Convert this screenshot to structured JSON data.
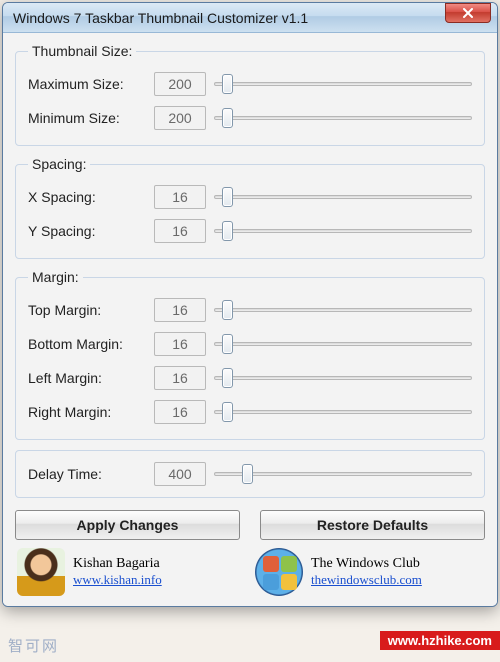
{
  "window": {
    "title": "Windows 7 Taskbar Thumbnail Customizer v1.1"
  },
  "groups": {
    "thumb": {
      "legend": "Thumbnail Size:",
      "max_label": "Maximum Size:",
      "max_value": "200",
      "min_label": "Minimum Size:",
      "min_value": "200"
    },
    "spacing": {
      "legend": "Spacing:",
      "x_label": "X Spacing:",
      "x_value": "16",
      "y_label": "Y Spacing:",
      "y_value": "16"
    },
    "margin": {
      "legend": "Margin:",
      "top_label": "Top Margin:",
      "top_value": "16",
      "bottom_label": "Bottom Margin:",
      "bottom_value": "16",
      "left_label": "Left Margin:",
      "left_value": "16",
      "right_label": "Right Margin:",
      "right_value": "16"
    },
    "delay": {
      "label": "Delay Time:",
      "value": "400"
    }
  },
  "buttons": {
    "apply": "Apply Changes",
    "restore": "Restore Defaults"
  },
  "credits": {
    "author_name": "Kishan Bagaria",
    "author_link": "www.kishan.info",
    "site_name": "The Windows Club",
    "site_link": "thewindowsclub.com"
  },
  "watermarks": {
    "left": "智可网",
    "right": "www.hzhike.com"
  }
}
